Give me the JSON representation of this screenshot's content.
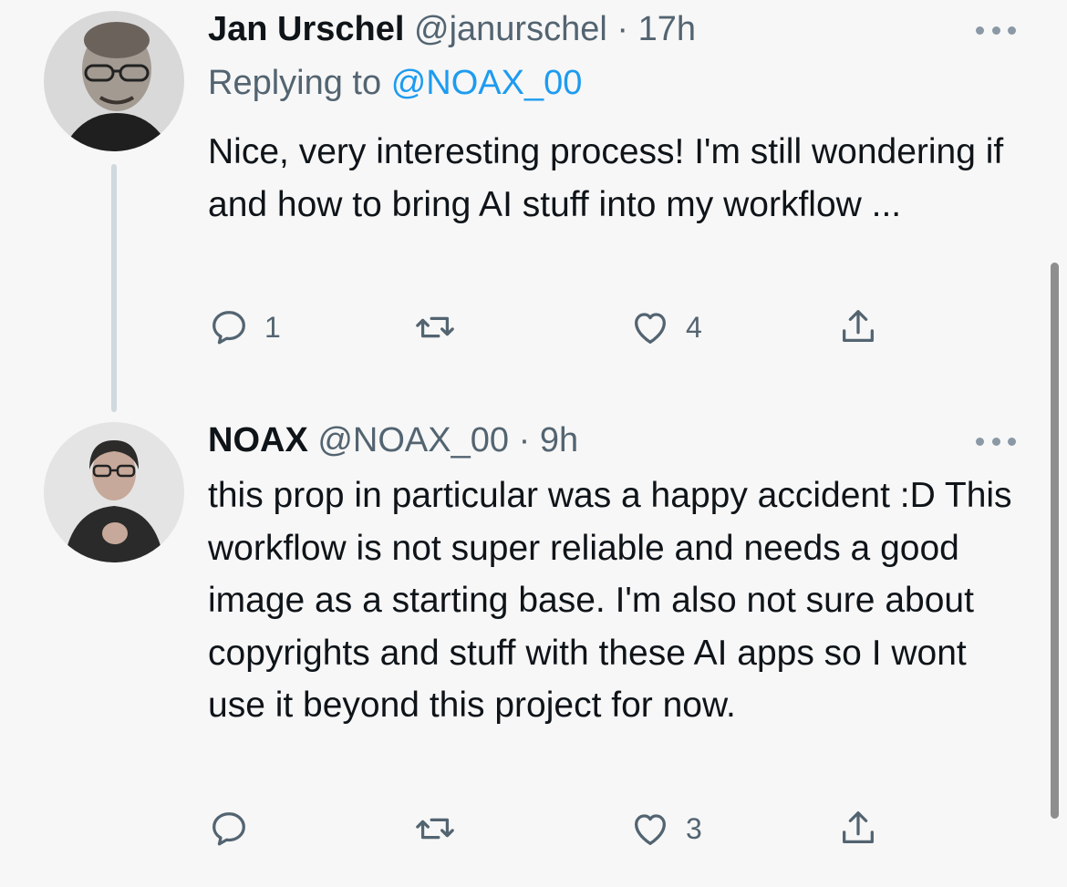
{
  "tweets": [
    {
      "author_name": "Jan Urschel",
      "handle": "@janurschel",
      "separator": "·",
      "time": "17h",
      "replying_prefix": "Replying to",
      "replying_to": "@NOAX_00",
      "text": "Nice, very interesting process! I'm still wondering if and how to bring AI stuff into my workflow ...",
      "actions": {
        "reply_count": "1",
        "retweet_count": "",
        "like_count": "4"
      }
    },
    {
      "author_name": "NOAX",
      "handle": "@NOAX_00",
      "separator": "·",
      "time": "9h",
      "text": "this prop in particular was a happy accident :D This workflow is not super reliable and needs a good image as a starting base. I'm also not sure about copyrights and stuff with these AI apps so I wont use it beyond this project for now.",
      "actions": {
        "reply_count": "",
        "retweet_count": "",
        "like_count": "3"
      }
    }
  ],
  "icons": {
    "more": "more-horizontal-icon",
    "reply": "reply-bubble-icon",
    "retweet": "retweet-icon",
    "like": "heart-icon",
    "share": "share-icon"
  },
  "colors": {
    "background": "#f7f7f7",
    "text": "#0f1419",
    "secondary": "#536471",
    "link": "#1d9bf0",
    "thread_line": "#cfd9de"
  }
}
